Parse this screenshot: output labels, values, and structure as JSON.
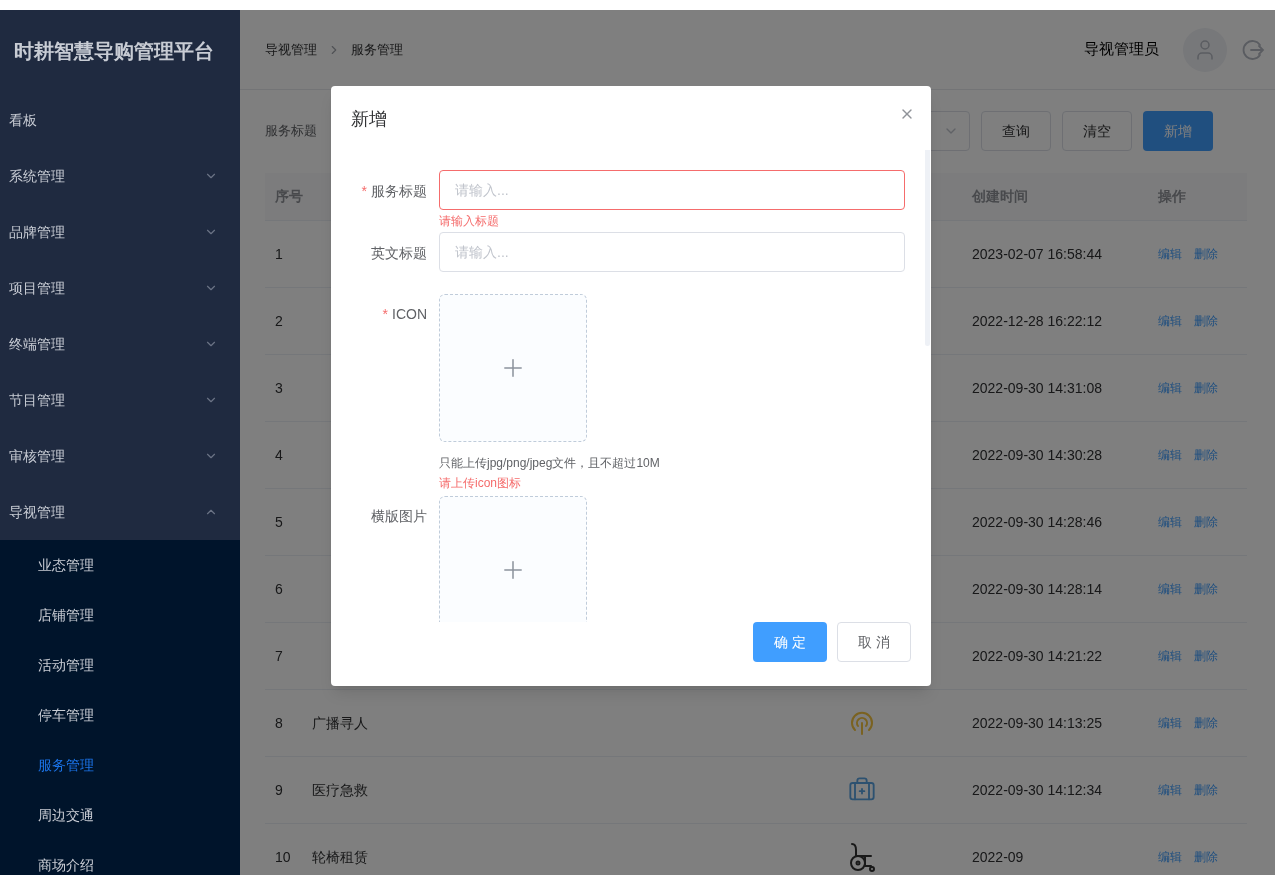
{
  "app_title": "时耕智慧导购管理平台",
  "sidebar": {
    "items": [
      {
        "label": "看板",
        "kind": "link"
      },
      {
        "label": "系统管理",
        "kind": "submenu",
        "expanded": false
      },
      {
        "label": "品牌管理",
        "kind": "submenu",
        "expanded": false
      },
      {
        "label": "项目管理",
        "kind": "submenu",
        "expanded": false
      },
      {
        "label": "终端管理",
        "kind": "submenu",
        "expanded": false
      },
      {
        "label": "节目管理",
        "kind": "submenu",
        "expanded": false
      },
      {
        "label": "审核管理",
        "kind": "submenu",
        "expanded": false
      },
      {
        "label": "导视管理",
        "kind": "submenu",
        "expanded": true,
        "children": [
          {
            "label": "业态管理",
            "selected": false
          },
          {
            "label": "店铺管理",
            "selected": false
          },
          {
            "label": "活动管理",
            "selected": false
          },
          {
            "label": "停车管理",
            "selected": false
          },
          {
            "label": "服务管理",
            "selected": true
          },
          {
            "label": "周边交通",
            "selected": false
          },
          {
            "label": "商场介绍",
            "selected": false
          }
        ]
      }
    ]
  },
  "header": {
    "breadcrumb": [
      "导视管理",
      "服务管理"
    ],
    "user_name": "导视管理员"
  },
  "filter": {
    "label": "服务标题",
    "buttons": [
      {
        "label": "查询",
        "kind": "default"
      },
      {
        "label": "清空",
        "kind": "default"
      },
      {
        "label": "新增",
        "kind": "primary"
      }
    ]
  },
  "table": {
    "index_header": "序号",
    "time_header": "创建时间",
    "actions_header": "操作",
    "rows": [
      {
        "index": "1",
        "time": "2023-02-07 16:58:44",
        "actions": [
          "编辑",
          "删除"
        ]
      },
      {
        "index": "2",
        "time": "2022-12-28 16:22:12",
        "actions": [
          "编辑",
          "删除"
        ]
      },
      {
        "index": "3",
        "time": "2022-09-30 14:31:08",
        "actions": [
          "编辑",
          "删除"
        ]
      },
      {
        "index": "4",
        "time": "2022-09-30 14:30:28",
        "actions": [
          "编辑",
          "删除"
        ]
      },
      {
        "index": "5",
        "time": "2022-09-30 14:28:46",
        "actions": [
          "编辑",
          "删除"
        ]
      },
      {
        "index": "6",
        "time": "2022-09-30 14:28:14",
        "actions": [
          "编辑",
          "删除"
        ]
      },
      {
        "index": "7",
        "time": "2022-09-30 14:21:22",
        "actions": [
          "编辑",
          "删除"
        ]
      },
      {
        "index": "8",
        "name": "广播寻人",
        "icon": {
          "kind": "broadcast"
        },
        "time": "2022-09-30 14:13:25",
        "actions": [
          "编辑",
          "删除"
        ]
      },
      {
        "index": "9",
        "name": "医疗急救",
        "icon": {
          "kind": "medical-kit"
        },
        "time": "2022-09-30 14:12:34",
        "actions": [
          "编辑",
          "删除"
        ]
      },
      {
        "index": "10",
        "name": "轮椅租赁",
        "icon": {
          "kind": "wheelchair"
        },
        "time": "2022-09",
        "actions": [
          "编辑",
          "删除"
        ]
      }
    ]
  },
  "dialog": {
    "title": "新增",
    "fields": [
      {
        "kind": "text",
        "label": "服务标题",
        "required_mark": "*",
        "placeholder": "请输入...",
        "error": "请输入标题"
      },
      {
        "kind": "text",
        "label": "英文标题",
        "placeholder": "请输入..."
      },
      {
        "kind": "upload",
        "label": "ICON",
        "required_mark": "*",
        "hint": "只能上传jpg/png/jpeg文件，且不超过10M",
        "error": "请上传icon图标"
      },
      {
        "kind": "upload",
        "label": "横版图片"
      }
    ],
    "buttons": [
      {
        "label": "确 定",
        "kind": "primary"
      },
      {
        "label": "取 消",
        "kind": "default"
      }
    ]
  }
}
